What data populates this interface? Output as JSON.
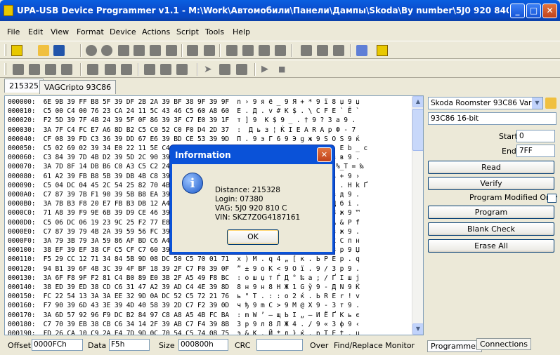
{
  "window": {
    "title": "UPA-USB Device Programmer v1.1  - M:\\Work\\Автомобили\\Панели\\Дампы\\Skoda\\By number\\5J0 920 840C\\2...",
    "minimize": "_",
    "maximize": "□",
    "close": "✕"
  },
  "menu": [
    "File",
    "Edit",
    "View",
    "Format",
    "Device",
    "Actions",
    "Script",
    "Tools",
    "Help"
  ],
  "tabs": [
    "215325",
    "VAGCripto 93C86"
  ],
  "hex": {
    "lines": [
      "000000:  6E 9B 39 FF B8 5F 39 DF 2B 2A 39 BF 38 9F 39 9F  n › 9 я ё _ 9 Я + * 9 ї 8 џ 9 џ",
      "000010:  C5 00 C4 00 76 23 CA 24 11 5C 43 46 C5 60 A8 60  Е . Д . v # К $ . \\ C F E ` Ё `",
      "000020:  F2 5D 39 7F 4B 24 39 5F 0F 86 39 3F C7 E0 39 1F  т ] 9  K $ 9 _ . † 9 ? З а 9 .",
      "000030:  3A 7F C4 FC E7 A6 8D B2 C5 C0 52 C0 F0 D4 2D 37  :  Д ь з ¦ Ќ І Е А R А р Ф - 7",
      "000040:  CF 08 39 FD C3 36 39 DD 67 E6 39 BD CE 53 39 9D  П . 9 э Г 6 9 Э g ж 9 Ѕ О S 9 ќ",
      "000050:  C5 02 69 02 39 34 E0 22 11 5E C4 3E A0 4D 29 4D  Е . i . 9 4 а \" . ^ Д >   E b _ c",
      "000060:  C3 84 39 7D 4B D2 39 5D 2C 90 39 3D C3 B3 B5 0B  Г „ 9 } K Т 9 ] , ђ 9 = з в 9 .",
      "000070:  3A 7D 8F 14 DB B6 C0 A3 C5 C2 24 25 7F DC 54 BD  : } Џ . Ы ¶ А Ј Е В $ %  %_T = ‰",
      "000080:  61 A2 39 FB B8 5B 39 DB 4B C8 39 BB 24 E4 39 9B  a ў 9 ы ё [ 9 Ы K И 9 » ь + 9 ›",
      "000090:  C5 04 DC 04 45 2C 54 25 82 70 4B 2D 80 A1 C4 AD  Е . Ь . E , T % ‚ p K -   . Н k Ґ",
      "0000A0:  C7 87 39 7B F1 90 39 5B B8 EA 39 3B 3F 34 39 1B  З ‡ 9 { с ђ 9 [ ё к 9 ; з д 9 .",
      "0000B0:  3A 7B B3 F8 20 E7 FB B3 DB 12 A4 BC D4 8B 35 AF  : { і ш   з ы і Ы . ¤ ј Д б і .",
      "0000C0:  71 A8 39 F9 9E 6B 39 D9 CE 46 39 B9 38 9F 39 99  q Ё 9 щ ћ k 9 Щ О F 9 № 8 ж 9 ™",
      "0000D0:  C5 06 DC 06 19 23 9C 25 F2 77 E8 A5 CC 7C 41 A0  Е . Ь . . # њ % т w и Ґ А & P f",
      "0000E0:  C7 87 39 79 4B 2A 39 59 56 FC 39 39 1B B6 39 19  З ‡ 9 y K * 9 Y V ь 9 9 з ж 9 .",
      "0000F0:  3A 79 3B 79 3A 59 86 AF BD C6 A4 CE A8 D1 C3 EF  : y ; y : Y † Ї Ѕ Ж ¤ О х С п н",
      "000100:  38 EF 39 EF 38 CF C5 CF C7 60 39 AF 3F 9F 39 8F  8 п 9 п 8 П Е П З ` 9 Ї 3 р 9 Џ",
      "000110:  F5 29 CC 12 71 34 84 5B 9D 08 DC 50 C5 70 01 71  х ) М . q 4 „ [ к . Ь Р Е р . q",
      "000120:  94 B1 39 6F 4B 3C 39 4F BF 18 39 2F C7 F0 39 0F  ” ± 9 o K < 9 O ї . 9 / З р 9 .",
      "000130:  3A 6F F8 9F F2 81 C4 B0 89 E0 3B 2F A5 49 F8 BC  : o ш џ т Ѓ Д ° ‰ а ; / Ґ I ш ј",
      "000140:  38 ED 39 ED 38 CD C6 31 47 A2 39 AD C4 4E 39 8D  8 н 9 н 8 Н Ж 1 G ў 9 - Д N 9 Ќ",
      "000150:  FC 22 54 13 3A 3A EE 32 9D 0A DC 52 C5 72 21 76  ь \" T . : : о 2 ќ . Ь R Е r ! v",
      "000160:  F7 90 39 6D 43 3E 39 4D 40 58 39 2D C7 F2 39 0D  ч ђ 9 m C > 9 M @ X 9 - З т 9 .",
      "000170:  3A 6D 57 92 96 F9 DC B2 84 97 C8 A8 A5 4B FC BA  : m W ’ – щ Ь І „ — И Ё Ґ K ь є",
      "000180:  C7 70 39 EB 38 CB C6 34 14 2F 39 AB C7 F4 39 8B  З р 9 л 8 Л Ж 4 . / 9 « З ф 9 ‹",
      "000190:  FD 26 CA 10 C9 2A E4 7D 9D 0C 70 54 C5 74 08 75  э & К . Й * д } ќ . p T Е t . u"
    ]
  },
  "status": {
    "offset_label": "Offset",
    "offset_value": "0000FCh",
    "data_label": "Data",
    "data_value": "F5h",
    "size_label": "Size",
    "size_value": "000800h",
    "crc_label": "CRC",
    "crc_value": "",
    "over": "Over",
    "find_replace": "Find/Replace Monitor"
  },
  "right": {
    "device_select": "Skoda Roomster 93C86 Var1",
    "device_type": "93C86 16-bit",
    "start_label": "Start",
    "start_value": "0",
    "end_label": "End",
    "end_value": "7FF",
    "read": "Read",
    "verify": "Verify",
    "program_modified_only": "Program Modified Only",
    "program": "Program",
    "blank_check": "Blank Check",
    "erase_all": "Erase All"
  },
  "bottom_tabs": [
    "Programmer",
    "Connections"
  ],
  "dialog": {
    "title": "Information",
    "close": "✕",
    "icon": "i",
    "distance": "Distance: 215328",
    "login": "Login: 07380",
    "vag": "VAG:  5J0 920 810 C",
    "vin": "VIN:  SKZ7Z0G4187161",
    "ok": "OK"
  },
  "colors": {
    "titlebar": "#0a52d8",
    "face": "#ece9d8",
    "field_border": "#7f9db9"
  }
}
